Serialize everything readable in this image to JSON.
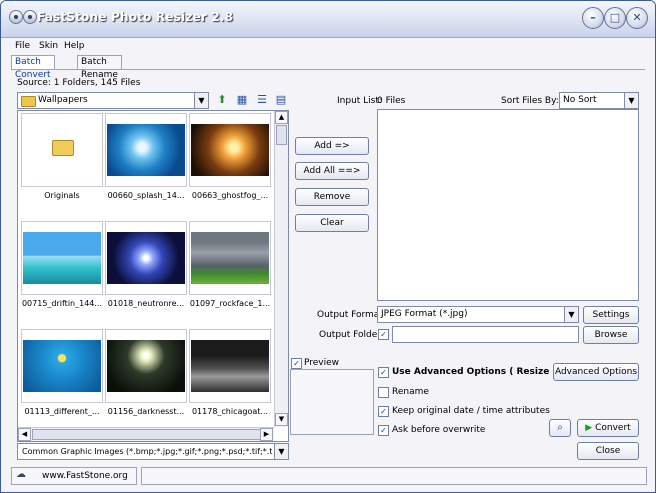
{
  "window": {
    "title": "FastStone Photo Resizer 2.8"
  },
  "menu": [
    "File",
    "Skin",
    "Help"
  ],
  "tabs": [
    {
      "label": "Batch Convert",
      "active": true
    },
    {
      "label": "Batch Rename",
      "active": false
    }
  ],
  "source": {
    "summary": "Source: 1 Folders, 145 Files",
    "folder": "Wallpapers"
  },
  "thumbnails": [
    {
      "label": "Originals",
      "kind": "folder"
    },
    {
      "label": "00660_splash_14..."
    },
    {
      "label": "00663_ghostfog_..."
    },
    {
      "label": "00715_driftin_144..."
    },
    {
      "label": "01018_neutronre..."
    },
    {
      "label": "01097_rockface_1..."
    },
    {
      "label": "01113_different_..."
    },
    {
      "label": "01156_darknesst..."
    },
    {
      "label": "01178_chicagoat..."
    }
  ],
  "filter": {
    "value": "Common Graphic Images (*.bmp;*.jpg;*.gif;*.png;*.psd;*.tif;*.tiff;*.p"
  },
  "input_list": {
    "label": "Input List:",
    "count": "0 Files"
  },
  "sort": {
    "label": "Sort Files By:",
    "value": "No Sort"
  },
  "buttons": {
    "add": "Add =>",
    "add_all": "Add All ==>",
    "remove": "Remove",
    "clear": "Clear",
    "settings": "Settings",
    "browse": "Browse",
    "advanced": "Advanced Options",
    "convert": "Convert",
    "close": "Close"
  },
  "output": {
    "format_label": "Output Format:",
    "format_value": "JPEG Format (*.jpg)",
    "folder_label": "Output Folder:",
    "folder_value": ""
  },
  "preview": {
    "label": "Preview",
    "checked": true
  },
  "options": {
    "advanced": {
      "label": "Use Advanced Options ( Resize ... )",
      "checked": true
    },
    "rename": {
      "label": "Rename",
      "checked": false
    },
    "keep_date": {
      "label": "Keep original date / time attributes",
      "checked": true
    },
    "ask_overwrite": {
      "label": "Ask before overwrite",
      "checked": true
    }
  },
  "status": {
    "url": "www.FastStone.org"
  },
  "colors": {
    "accent": "#0a3c9c",
    "convert_icon": "#17a317"
  }
}
